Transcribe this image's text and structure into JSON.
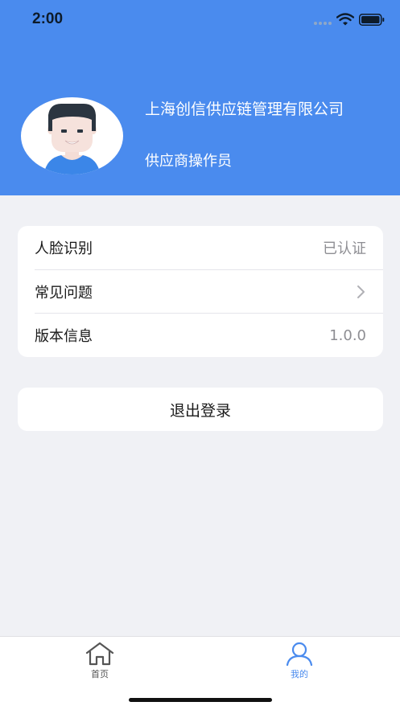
{
  "status_bar": {
    "time": "2:00",
    "icons": [
      "signal-icon",
      "wifi-icon",
      "battery-icon"
    ]
  },
  "profile": {
    "avatar_icon": "avatar-icon",
    "company_name": "上海创信供应链管理有限公司",
    "role": "供应商操作员"
  },
  "settings": {
    "face_recognition": {
      "label": "人脸识别",
      "value": "已认证"
    },
    "faq": {
      "label": "常见问题",
      "icon": "chevron-right-icon"
    },
    "version": {
      "label": "版本信息",
      "value": "1.0.0"
    }
  },
  "logout": {
    "label": "退出登录"
  },
  "tabbar": {
    "active": "mine",
    "tabs": [
      {
        "id": "home",
        "label": "首页",
        "icon": "home-icon"
      },
      {
        "id": "mine",
        "label": "我的",
        "icon": "user-icon"
      }
    ]
  },
  "colors": {
    "header": "#4a8bee",
    "background": "#f0f1f5",
    "accent": "#4a8bee",
    "secondary_text": "#8e8e93"
  }
}
